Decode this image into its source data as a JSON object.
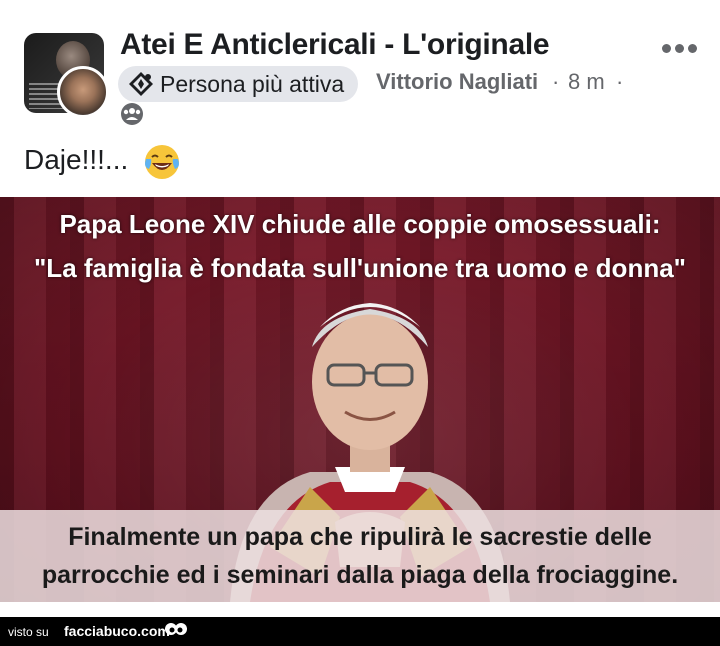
{
  "post": {
    "group_name": "Atei E Anticlericali - L'originale",
    "badge_label": "Persona più attiva",
    "author": "Vittorio Nagliati",
    "separator": "·",
    "time": "8 m",
    "text": "Daje!!!...",
    "icons": {
      "more": "more-options-icon",
      "badge": "top-contributor-icon",
      "audience": "group-audience-icon",
      "emoji": "tears-of-joy-emoji-icon"
    }
  },
  "image": {
    "headline_line1": "Papa Leone XIV chiude alle coppie omosessuali:",
    "headline_line2": "\"La famiglia è fondata sull'unione tra uomo e donna\"",
    "caption_line1": "Finalmente un papa che ripulirà le sacrestie delle",
    "caption_line2": "parrocchie ed i seminari dalla piaga della frociaggine."
  },
  "footer": {
    "prefix": "visto su",
    "site": "facciabuco.com"
  },
  "colors": {
    "background": "#ffffff",
    "text_primary": "#1c1e21",
    "text_secondary": "#65676b",
    "badge_bg": "#e4e6eb",
    "curtain": "#6b1322"
  }
}
